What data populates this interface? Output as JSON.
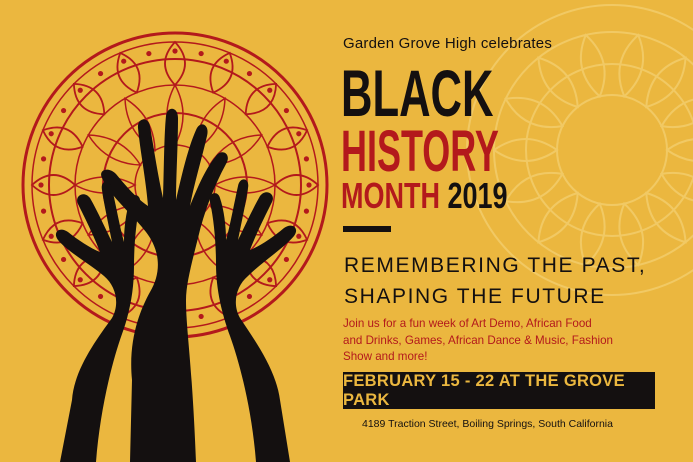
{
  "poster": {
    "intro": "Garden Grove High celebrates",
    "title_line1": "BLACK",
    "title_line2": "HISTORY",
    "title_month": "MONTH",
    "title_year": "2019",
    "tagline_line1": "REMEMBERING THE PAST,",
    "tagline_line2": "SHAPING THE FUTURE",
    "description": "Join us for a fun week of Art Demo, African Food and Drinks, Games, African Dance & Music, Fashion Show and more!",
    "date_bar": "FEBRUARY 15 - 22 AT THE GROVE PARK",
    "address": "4189  Traction Street, Boiling Springs, South California"
  },
  "colors": {
    "background": "#ebb73f",
    "accent_red": "#b3191c",
    "ink": "#141010"
  },
  "icons": [
    "mandala-ornament",
    "raised-hands-silhouette"
  ]
}
